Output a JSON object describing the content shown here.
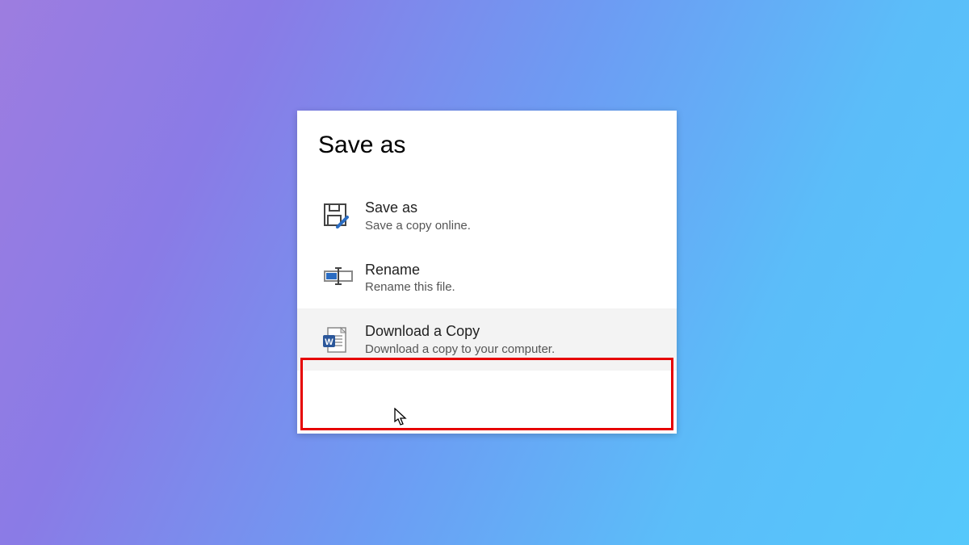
{
  "panel": {
    "title": "Save as",
    "items": [
      {
        "title": "Save as",
        "subtitle": "Save a copy online.",
        "icon": "save-as-icon"
      },
      {
        "title": "Rename",
        "subtitle": "Rename this file.",
        "icon": "rename-icon"
      },
      {
        "title": "Download a Copy",
        "subtitle": "Download a copy to your computer.",
        "icon": "word-document-icon"
      }
    ]
  },
  "highlighted_index": 2,
  "colors": {
    "highlight_border": "#e60000",
    "hover_bg": "#f3f3f3"
  }
}
